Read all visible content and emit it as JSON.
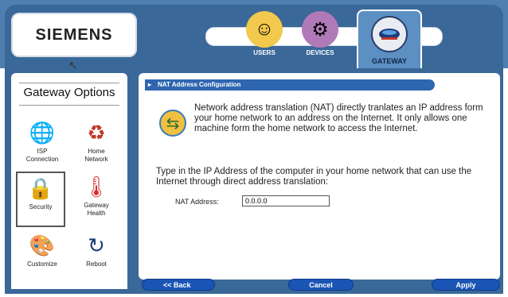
{
  "header": {
    "brand": "SIEMENS",
    "tabs": [
      {
        "label": "USERS",
        "icon": "users-icon"
      },
      {
        "label": "DEVICES",
        "icon": "devices-icon"
      },
      {
        "label": "GATEWAY",
        "icon": "gateway-icon",
        "active": true
      }
    ]
  },
  "sidebar": {
    "title": "Gateway Options",
    "items": [
      {
        "label_line1": "ISP",
        "label_line2": "Connection",
        "icon": "globe-icon"
      },
      {
        "label_line1": "Home",
        "label_line2": "Network",
        "icon": "network-icon"
      },
      {
        "label_line1": "Security",
        "label_line2": "",
        "icon": "lock-icon",
        "selected": true
      },
      {
        "label_line1": "Gateway",
        "label_line2": "Health",
        "icon": "thermometer-icon"
      },
      {
        "label_line1": "Customize",
        "label_line2": "",
        "icon": "palette-icon"
      },
      {
        "label_line1": "Reboot",
        "label_line2": "",
        "icon": "reboot-icon"
      }
    ]
  },
  "main": {
    "section_title": "NAT Address Configuration",
    "description": "Network address translation (NAT) directly tranlates an IP address form your home network to an address on the Internet. It only allows one machine form the home network to access the Internet.",
    "instruction": "Type in the IP Address of the computer in your home network that can use the Internet through direct address translation:",
    "nat_label": "NAT Address:",
    "nat_value": "0.0.0.0"
  },
  "footer": {
    "back_label": "<< Back",
    "cancel_label": "Cancel",
    "apply_label": "Apply"
  },
  "colors": {
    "frame_blue": "#3a6898",
    "button_blue": "#1a55b5",
    "header_bar": "#2f66b0"
  }
}
